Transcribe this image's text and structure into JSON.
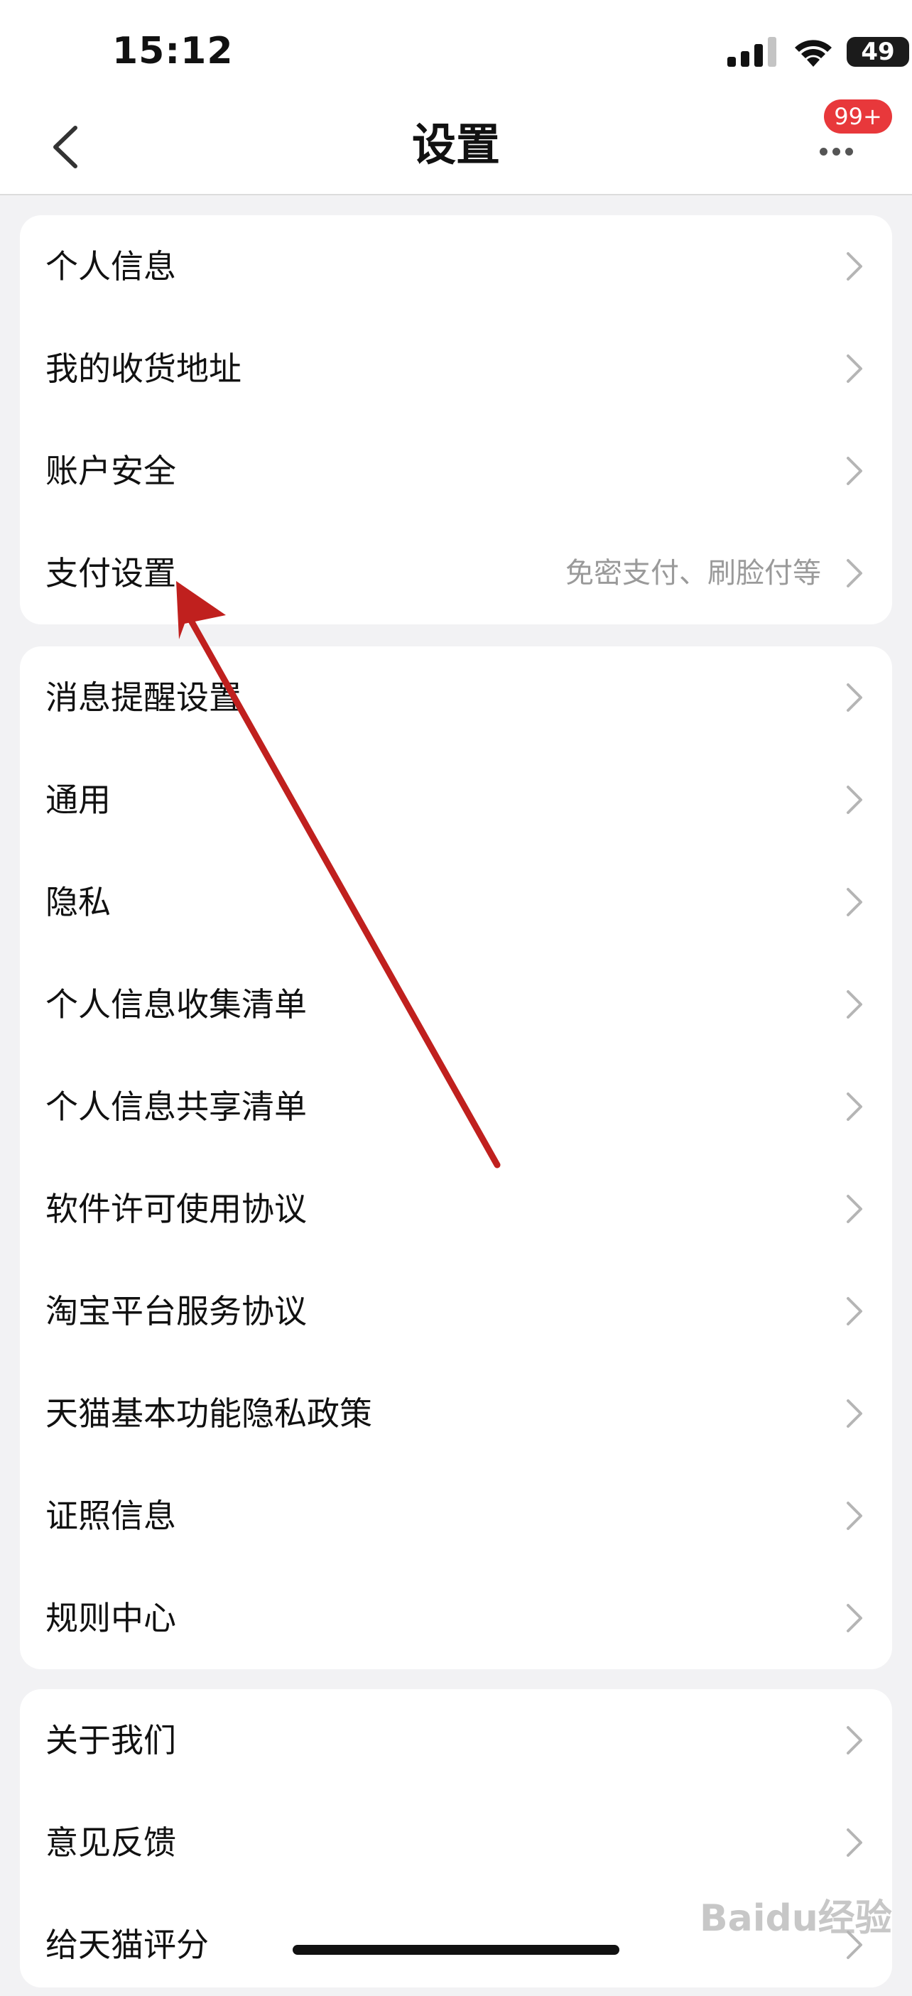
{
  "status_bar": {
    "time": "15:12",
    "battery": "49"
  },
  "nav": {
    "title": "设置",
    "badge": "99+"
  },
  "groups": [
    [
      {
        "label": "个人信息",
        "value": ""
      },
      {
        "label": "我的收货地址",
        "value": ""
      },
      {
        "label": "账户安全",
        "value": ""
      },
      {
        "label": "支付设置",
        "value": "免密支付、刷脸付等"
      }
    ],
    [
      {
        "label": "消息提醒设置",
        "value": ""
      },
      {
        "label": "通用",
        "value": ""
      },
      {
        "label": "隐私",
        "value": ""
      },
      {
        "label": "个人信息收集清单",
        "value": ""
      },
      {
        "label": "个人信息共享清单",
        "value": ""
      },
      {
        "label": "软件许可使用协议",
        "value": ""
      },
      {
        "label": "淘宝平台服务协议",
        "value": ""
      },
      {
        "label": "天猫基本功能隐私政策",
        "value": ""
      },
      {
        "label": "证照信息",
        "value": ""
      },
      {
        "label": "规则中心",
        "value": ""
      }
    ],
    [
      {
        "label": "关于我们",
        "value": ""
      },
      {
        "label": "意见反馈",
        "value": ""
      },
      {
        "label": "给天猫评分",
        "value": ""
      }
    ]
  ],
  "watermark": "Baidu经验",
  "colors": {
    "annotation_arrow": "#c0201e",
    "badge": "#e8383b",
    "chevron": "#b5b5b5"
  }
}
